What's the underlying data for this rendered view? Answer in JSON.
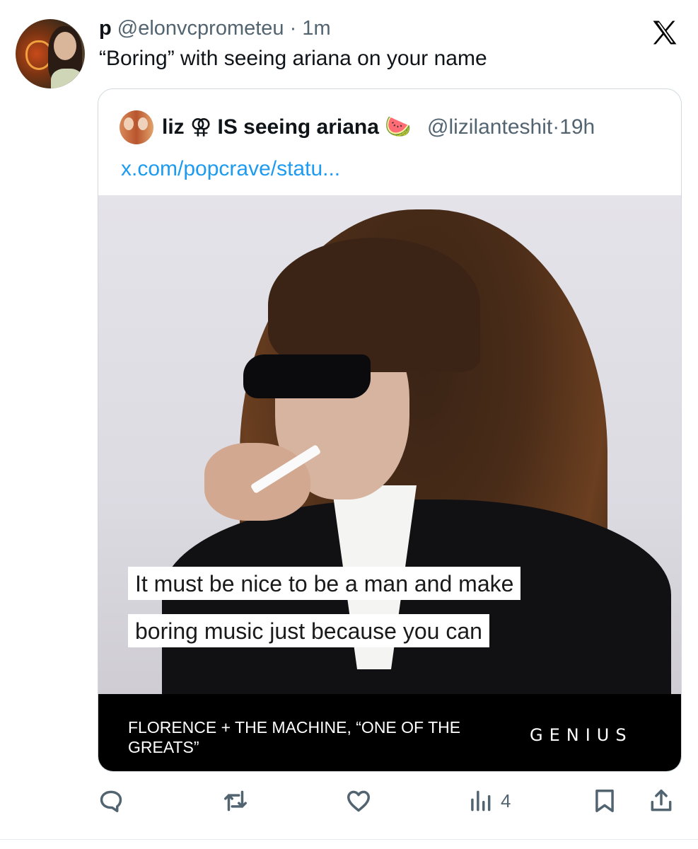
{
  "tweet": {
    "author_name": "p",
    "author_handle": "@elonvcprometeu",
    "separator": "·",
    "time": "1m",
    "text": "“Boring” with seeing ariana on your name"
  },
  "quoted_tweet": {
    "author_name": "liz",
    "name_symbol": "⚢",
    "name_rest": "IS seeing ariana",
    "name_emoji": "🍉",
    "author_handle": "@lizilanteshit",
    "separator": "·",
    "time": "19h",
    "link_text": "x.com/popcrave/statu..."
  },
  "media": {
    "caption_line_1": "It must be nice to be a man and make",
    "caption_line_2": "boring music just because you can",
    "footer_text": "FLORENCE + THE MACHINE, “ONE OF THE GREATS”",
    "brand": "GENIUS"
  },
  "actions": {
    "icons": [
      "reply-icon",
      "retweet-icon",
      "like-icon",
      "views-icon",
      "bookmark-icon",
      "share-icon"
    ],
    "views_count": "4"
  },
  "colors": {
    "text_primary": "#0f1419",
    "text_secondary": "#536471",
    "link": "#1d9bf0",
    "border": "#cfd9de"
  }
}
